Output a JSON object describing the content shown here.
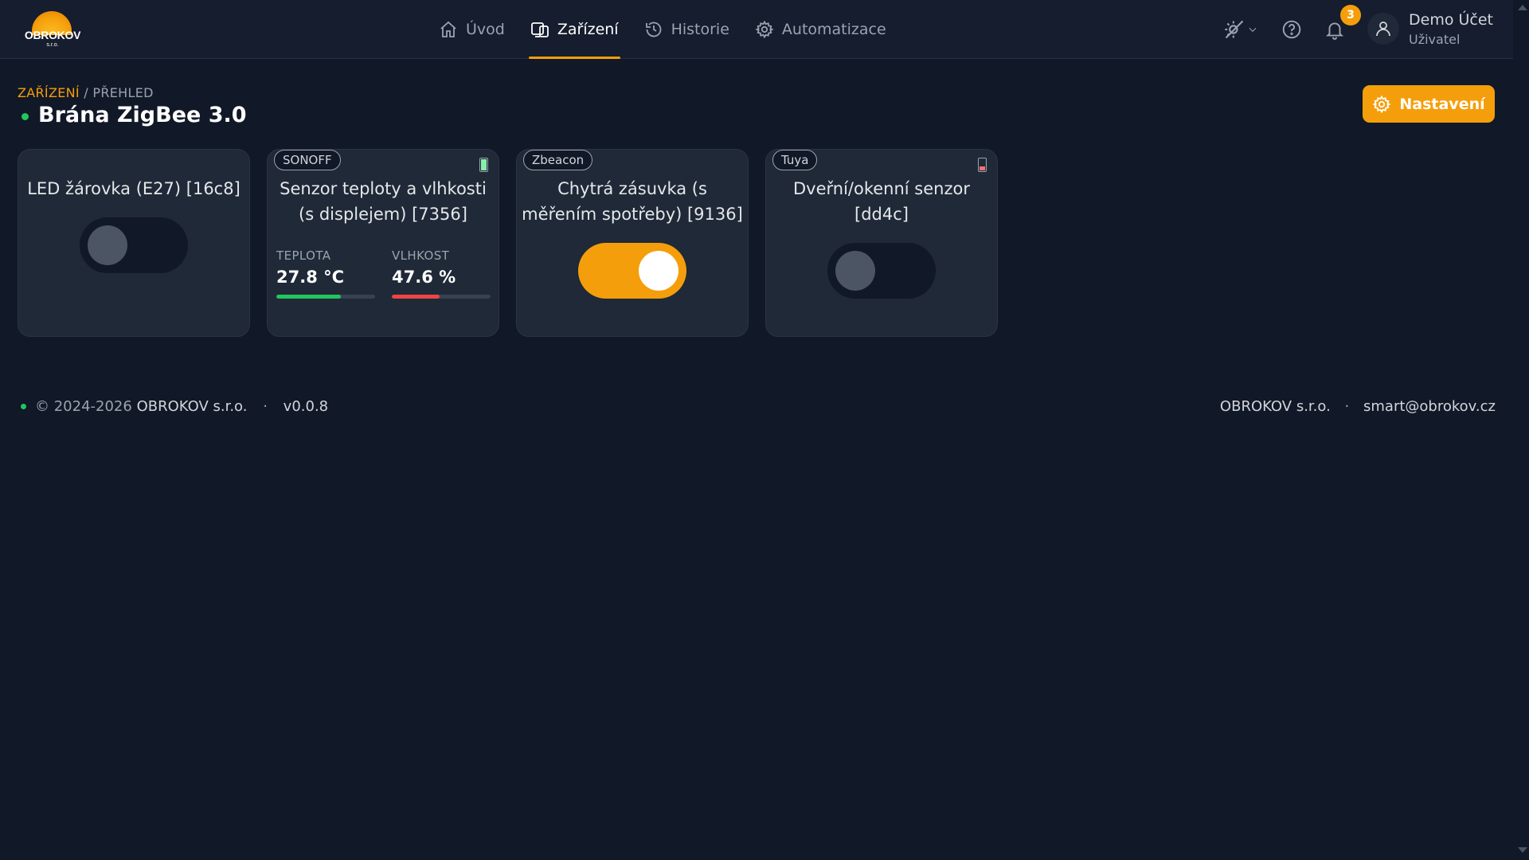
{
  "brand": {
    "logo_name": "OBROKOV",
    "logo_sub": "s.r.o.",
    "accent_color": "#f59e0b"
  },
  "nav": {
    "items": [
      {
        "label": "Úvod",
        "icon": "home-icon",
        "active": false
      },
      {
        "label": "Zařízení",
        "icon": "devices-icon",
        "active": true
      },
      {
        "label": "Historie",
        "icon": "history-icon",
        "active": false
      },
      {
        "label": "Automatizace",
        "icon": "gear-icon",
        "active": false
      }
    ]
  },
  "toolbar": {
    "theme_icon": "theme-toggle-icon",
    "help_icon": "help-icon",
    "notifications_icon": "bell-icon",
    "notifications_count": "3"
  },
  "user": {
    "name": "Demo Účet",
    "role": "Uživatel",
    "icon": "user-icon"
  },
  "breadcrumb": {
    "parent": "ZAŘÍZENÍ",
    "separator": "/",
    "current": "PŘEHLED"
  },
  "page": {
    "title": "Brána ZigBee 3.0",
    "status_color": "#22c55e",
    "settings_label": "Nastavení"
  },
  "devices": [
    {
      "title": "LED žárovka (E27) [16c8]",
      "brand": "",
      "toggle_on": false
    },
    {
      "title": "Senzor teploty a vlhkosti (s displejem) [7356]",
      "brand": "SONOFF",
      "battery_color": "#86efac",
      "battery_level": 0.85,
      "metrics": [
        {
          "label": "TEPLOTA",
          "value": "27.8 °C",
          "level": 0.65,
          "color": "#22c55e"
        },
        {
          "label": "VLHKOST",
          "value": "47.6 %",
          "level": 0.48,
          "color": "#ef4444"
        }
      ]
    },
    {
      "title": "Chytrá zásuvka (s měřením spotřeby) [9136]",
      "brand": "Zbeacon",
      "toggle_on": true
    },
    {
      "title": "Dveřní/okenní senzor [dd4c]",
      "brand": "Tuya",
      "battery_color": "#f87171",
      "battery_level": 0.3,
      "toggle_on": false
    }
  ],
  "footer": {
    "copyright": "© 2024-2026",
    "company": "OBROKOV s.r.o.",
    "separator": "·",
    "version": "v0.0.8",
    "right_company": "OBROKOV s.r.o.",
    "email": "smart@obrokov.cz"
  }
}
